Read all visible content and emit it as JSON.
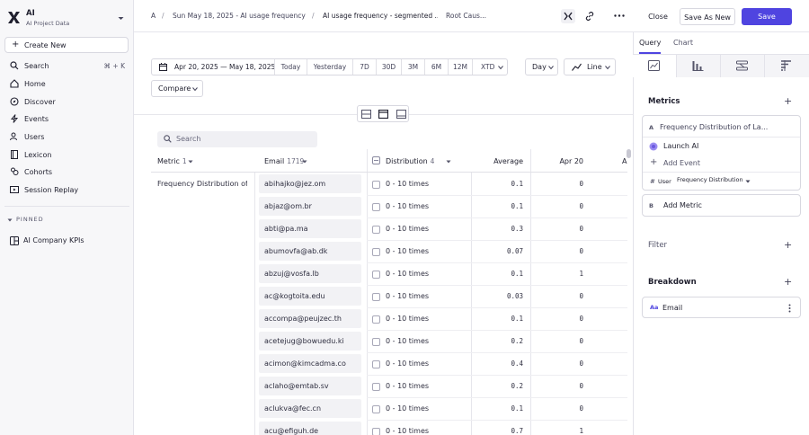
{
  "sidebar": {
    "org_name": "AI",
    "org_sub": "AI Project Data",
    "create_label": "Create New",
    "search_label": "Search",
    "search_shortcut": "⌘ + K",
    "items": [
      {
        "label": "Home"
      },
      {
        "label": "Discover"
      },
      {
        "label": "Events"
      },
      {
        "label": "Users"
      },
      {
        "label": "Lexicon"
      },
      {
        "label": "Cohorts"
      },
      {
        "label": "Session Replay"
      }
    ],
    "pinned_label": "PINNED",
    "pinned_items": [
      {
        "label": "AI Company KPIs"
      }
    ]
  },
  "topbar": {
    "crumbs": [
      "A",
      "Sun May 18, 2025 - AI usage frequency ...",
      "AI usage frequency - segmented ...",
      "Root Caus..."
    ],
    "close_label": "Close",
    "save_as_label": "Save As New",
    "save_label": "Save"
  },
  "controls": {
    "date_range": "Apr 20, 2025 — May 18, 2025",
    "ranges": [
      "Today",
      "Yesterday",
      "7D",
      "30D",
      "3M",
      "6M",
      "12M",
      "XTD"
    ],
    "compare_label": "Compare",
    "interval": "Day",
    "chart_type": "Line"
  },
  "table": {
    "search_placeholder": "Search",
    "headers": {
      "metric": "Metric",
      "metric_count": "1",
      "email": "Email",
      "email_count": "1719",
      "distribution": "Distribution",
      "distribution_count": "4",
      "average": "Average",
      "apr20": "Apr 20",
      "next": "A"
    },
    "metric_value": "Frequency Distribution of ...",
    "rows": [
      {
        "email": "abihajko@jez.om",
        "dist": "0 - 10 times",
        "avg": "0.1",
        "apr": "0"
      },
      {
        "email": "abjaz@om.br",
        "dist": "0 - 10 times",
        "avg": "0.1",
        "apr": "0"
      },
      {
        "email": "abti@pa.ma",
        "dist": "0 - 10 times",
        "avg": "0.3",
        "apr": "0"
      },
      {
        "email": "abumovfa@ab.dk",
        "dist": "0 - 10 times",
        "avg": "0.07",
        "apr": "0"
      },
      {
        "email": "abzuj@vosfa.lb",
        "dist": "0 - 10 times",
        "avg": "0.1",
        "apr": "1"
      },
      {
        "email": "ac@kogtoita.edu",
        "dist": "0 - 10 times",
        "avg": "0.03",
        "apr": "0"
      },
      {
        "email": "accompa@peujzec.th",
        "dist": "0 - 10 times",
        "avg": "0.1",
        "apr": "0"
      },
      {
        "email": "acetejug@bowuedu.ki",
        "dist": "0 - 10 times",
        "avg": "0.2",
        "apr": "0"
      },
      {
        "email": "acimon@kimcadma.co",
        "dist": "0 - 10 times",
        "avg": "0.4",
        "apr": "0"
      },
      {
        "email": "aclaho@emtab.sv",
        "dist": "0 - 10 times",
        "avg": "0.2",
        "apr": "0"
      },
      {
        "email": "aclukva@fec.cn",
        "dist": "0 - 10 times",
        "avg": "0.1",
        "apr": "0"
      },
      {
        "email": "acu@efiguh.de",
        "dist": "0 - 10 times",
        "avg": "0.7",
        "apr": "1"
      }
    ]
  },
  "panel": {
    "tabs": [
      "Query",
      "Chart"
    ],
    "metrics_label": "Metrics",
    "metric_a_title": "Frequency Distribution of La...",
    "metric_a_event": "Launch AI",
    "add_event_label": "Add Event",
    "user_label": "User",
    "freq_label": "Frequency Distribution",
    "add_metric_label": "Add Metric",
    "letter_a": "A",
    "letter_b": "B",
    "filter_label": "Filter",
    "breakdown_label": "Breakdown",
    "breakdown_prefix": "Aa",
    "breakdown_value": "Email",
    "hash": "#"
  },
  "colors": {
    "accent": "#4f44e0"
  }
}
